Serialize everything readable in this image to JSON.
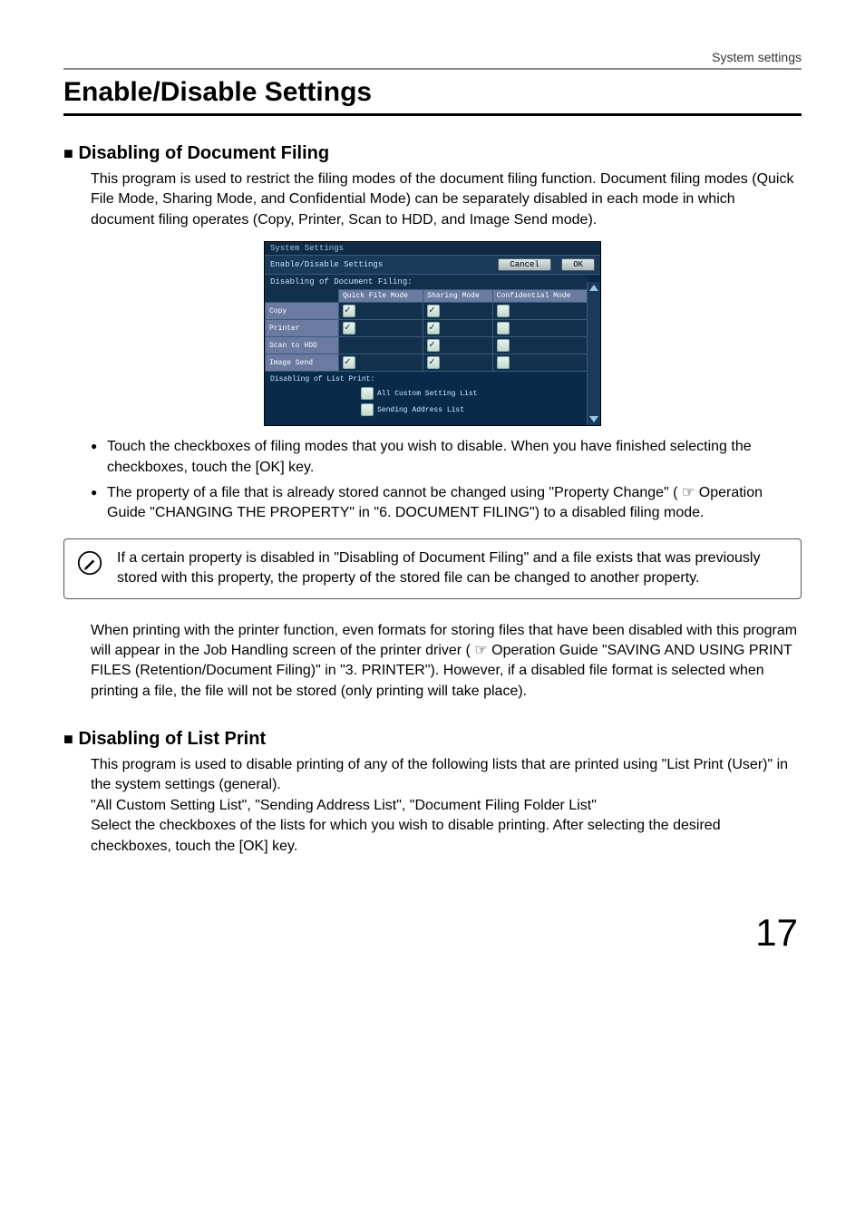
{
  "header": {
    "running": "System settings"
  },
  "title": "Enable/Disable Settings",
  "section1": {
    "heading": "Disabling of Document Filing",
    "para1": "This program is used to restrict the filing modes of the document filing function. Document filing modes (Quick File Mode, Sharing Mode, and Confidential Mode) can be separately disabled in each mode in which document filing operates (Copy, Printer, Scan to HDD, and Image Send mode).",
    "bullet1": "Touch the checkboxes of filing modes that you wish to disable. When you have finished selecting the checkboxes, touch the [OK] key.",
    "bullet2": "The property of a file that is already stored cannot be changed using \"Property Change\" ( ☞ Operation Guide \"CHANGING THE PROPERTY\" in \"6. DOCUMENT FILING\") to a disabled filing mode."
  },
  "ui": {
    "sysSettings": "System Settings",
    "eds": "Enable/Disable Settings",
    "cancel": "Cancel",
    "ok": "OK",
    "disDocFiling": "Disabling of Document Filing:",
    "cols": {
      "c1": "Quick File Mode",
      "c2": "Sharing Mode",
      "c3": "Confidential Mode"
    },
    "rows": {
      "r1": "Copy",
      "r2": "Printer",
      "r3": "Scan to HDD",
      "r4": "Image Send"
    },
    "disListPrint": "Disabling of List Print:",
    "opt1": "All Custom Setting List",
    "opt2": "Sending Address List"
  },
  "note": "If a certain property is disabled in \"Disabling of Document Filing\" and a file exists that was previously stored with this property, the property of the stored file can be changed to another property.",
  "para2": "When printing with the printer function, even formats for storing files that have been disabled with this program will appear in the Job Handling screen of the printer driver ( ☞  Operation Guide \"SAVING AND USING PRINT FILES (Retention/Document Filing)\" in \"3. PRINTER\"). However, if a disabled file format is selected when printing a file, the file will not be stored (only printing will take place).",
  "section2": {
    "heading": "Disabling of List Print",
    "para": "This program is used to disable printing of any of the following lists that are printed using \"List Print (User)\" in the system settings (general).\n\"All Custom Setting List\", \"Sending Address List\", \"Document Filing Folder List\"\nSelect the checkboxes of the lists for which you wish to disable printing. After selecting the desired checkboxes, touch the [OK] key."
  },
  "pageNumber": "17"
}
